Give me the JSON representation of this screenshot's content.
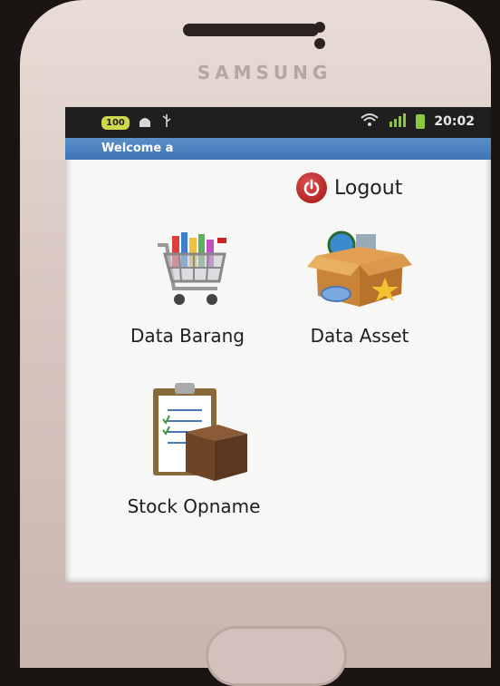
{
  "device": {
    "brand": "SAMSUNG"
  },
  "status_bar": {
    "badge": "100",
    "time": "20:02",
    "icons": [
      "android-debug-icon",
      "usb-icon",
      "wifi-icon",
      "signal-icon",
      "battery-icon"
    ]
  },
  "app": {
    "title": "Welcome a",
    "logout_label": "Logout"
  },
  "menu": {
    "items": [
      {
        "label": "Data Barang",
        "icon": "shopping-cart-icon"
      },
      {
        "label": "Data Asset",
        "icon": "box-icon"
      },
      {
        "label": "Stock Opname",
        "icon": "clipboard-box-icon"
      }
    ]
  },
  "colors": {
    "title_bar": "#3f75b5",
    "logout_red": "#c21f1f",
    "status_bar": "#1f1f1f"
  }
}
